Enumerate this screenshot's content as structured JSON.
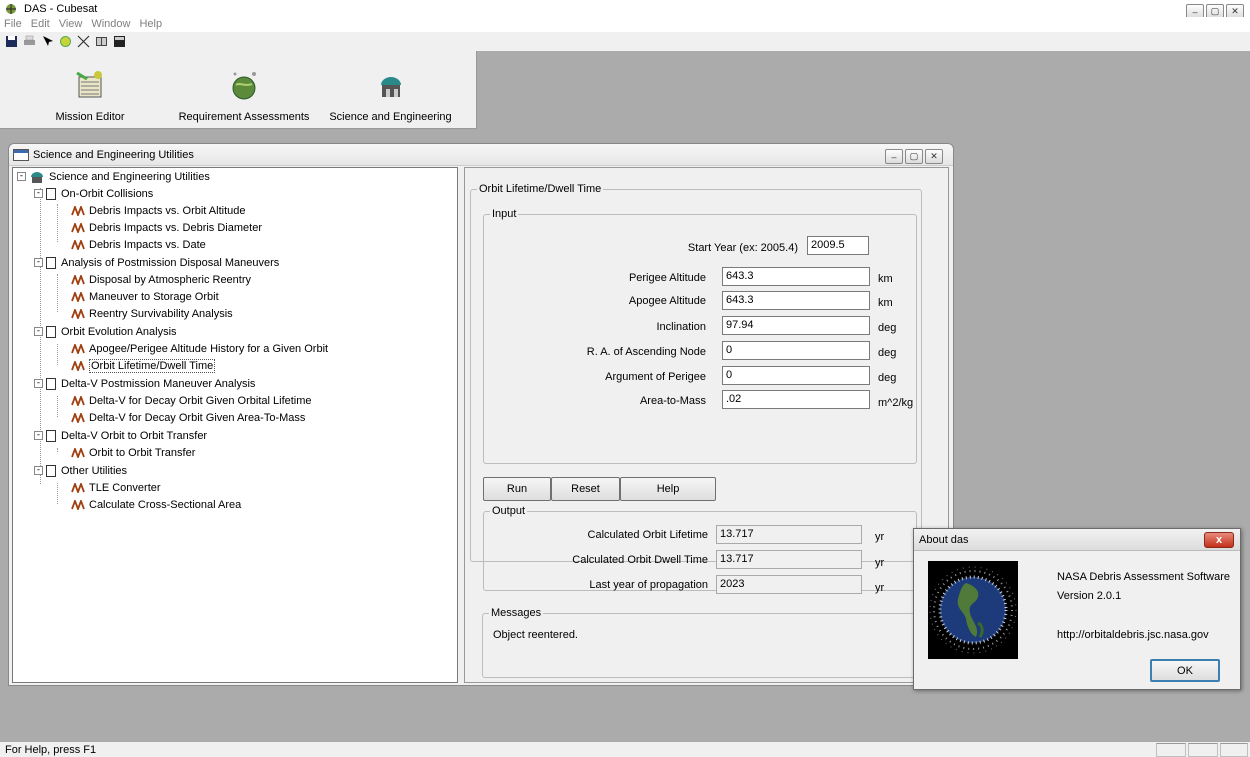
{
  "window": {
    "title": "DAS - Cubesat"
  },
  "menu": [
    "File",
    "Edit",
    "View",
    "Window",
    "Help"
  ],
  "big_toolbar": [
    {
      "label": "Mission Editor"
    },
    {
      "label": "Requirement Assessments"
    },
    {
      "label": "Science and Engineering"
    }
  ],
  "child": {
    "title": "Science and Engineering Utilities"
  },
  "tree": {
    "root": "Science and Engineering Utilities",
    "groups": [
      {
        "label": "On-Orbit Collisions",
        "items": [
          "Debris Impacts vs. Orbit Altitude",
          "Debris Impacts vs. Debris Diameter",
          "Debris Impacts vs. Date"
        ]
      },
      {
        "label": "Analysis of Postmission Disposal Maneuvers",
        "items": [
          "Disposal by Atmospheric Reentry",
          "Maneuver to Storage Orbit",
          "Reentry Survivability Analysis"
        ]
      },
      {
        "label": "Orbit Evolution Analysis",
        "items": [
          "Apogee/Perigee Altitude History for a Given Orbit",
          "Orbit Lifetime/Dwell Time"
        ]
      },
      {
        "label": "Delta-V Postmission Maneuver Analysis",
        "items": [
          "Delta-V for Decay Orbit Given Orbital Lifetime",
          "Delta-V for Decay Orbit Given Area-To-Mass"
        ]
      },
      {
        "label": "Delta-V Orbit to Orbit Transfer",
        "items": [
          "Orbit to Orbit Transfer"
        ]
      },
      {
        "label": "Other Utilities",
        "items": [
          "TLE Converter",
          "Calculate Cross-Sectional Area"
        ]
      }
    ]
  },
  "panel": {
    "title": "Orbit Lifetime/Dwell Time",
    "input_title": "Input",
    "inputs": {
      "start_year": {
        "label": "Start Year (ex: 2005.4)",
        "value": "2009.5",
        "unit": ""
      },
      "perigee": {
        "label": "Perigee Altitude",
        "value": "643.3",
        "unit": "km"
      },
      "apogee": {
        "label": "Apogee Altitude",
        "value": "643.3",
        "unit": "km"
      },
      "inclination": {
        "label": "Inclination",
        "value": "97.94",
        "unit": "deg"
      },
      "raan": {
        "label": "R. A. of Ascending Node",
        "value": "0",
        "unit": "deg"
      },
      "argp": {
        "label": "Argument of Perigee",
        "value": "0",
        "unit": "deg"
      },
      "area_mass": {
        "label": "Area-to-Mass",
        "value": ".02",
        "unit": "m^2/kg"
      }
    },
    "buttons": {
      "run": "Run",
      "reset": "Reset",
      "help": "Help"
    },
    "output_title": "Output",
    "outputs": {
      "lifetime": {
        "label": "Calculated Orbit Lifetime",
        "value": "13.717",
        "unit": "yr"
      },
      "dwell": {
        "label": "Calculated Orbit Dwell Time",
        "value": "13.717",
        "unit": "yr"
      },
      "last_year": {
        "label": "Last year of propagation",
        "value": "2023",
        "unit": "yr"
      }
    },
    "messages_title": "Messages",
    "message": "Object reentered."
  },
  "about": {
    "title": "About das",
    "line1": "NASA Debris Assessment Software",
    "line2": "Version 2.0.1",
    "url": "http://orbitaldebris.jsc.nasa.gov",
    "ok": "OK",
    "close": "x"
  },
  "status": {
    "text": "For Help, press F1"
  },
  "window_buttons": {
    "minimize": "–",
    "maximize": "▢",
    "close": "✕"
  }
}
